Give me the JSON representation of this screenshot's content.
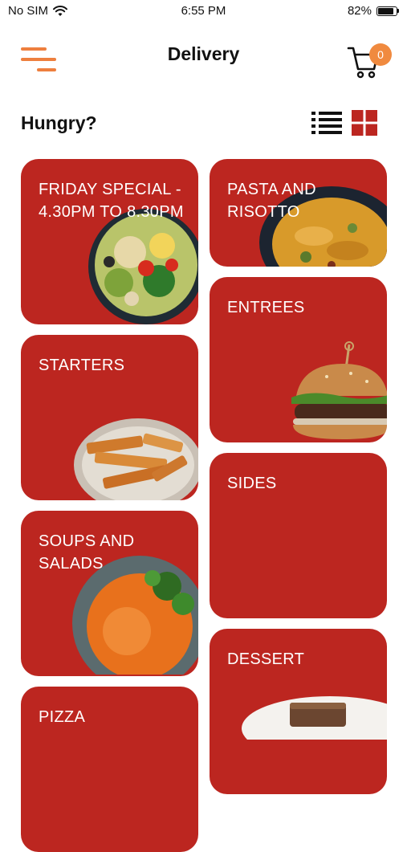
{
  "status_bar": {
    "carrier": "No SIM",
    "time": "6:55 PM",
    "battery": "82%"
  },
  "header": {
    "title": "Delivery",
    "cart_count": "0"
  },
  "section": {
    "heading": "Hungry?"
  },
  "colors": {
    "accent": "#ee7f3e",
    "card": "#bc2620",
    "badge": "#f08a3f"
  },
  "categories": [
    {
      "label": "FRIDAY SPECIAL - 4.30PM TO 8.30PM",
      "image": "salad-bowl"
    },
    {
      "label": "PASTA AND RISOTTO",
      "image": "pasta-bowl"
    },
    {
      "label": "ENTREES",
      "image": "burger"
    },
    {
      "label": "STARTERS",
      "image": "fries-bowl"
    },
    {
      "label": "SIDES",
      "image": ""
    },
    {
      "label": "SOUPS AND SALADS",
      "image": "soup-bowl"
    },
    {
      "label": "DESSERT",
      "image": "dessert-plate"
    },
    {
      "label": "PIZZA",
      "image": ""
    }
  ]
}
